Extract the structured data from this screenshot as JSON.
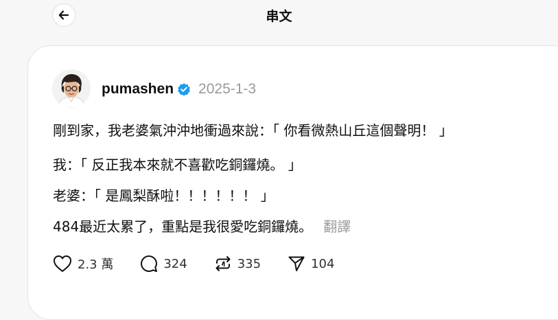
{
  "header": {
    "title": "串文",
    "back_icon": "arrow-left-icon"
  },
  "post": {
    "author": {
      "username": "pumashen",
      "verified": true,
      "verified_color": "#1d9bf0"
    },
    "date": "2025-1-3",
    "lines": [
      "剛到家，我老婆氣沖沖地衝過來說：「 你看微熱山丘這個聲明！ 」",
      "我：「 反正我本來就不喜歡吃銅鑼燒。 」",
      "老婆：「 是鳳梨酥啦！！！！！！ 」",
      "484最近太累了，重點是我很愛吃銅鑼燒。"
    ],
    "translate_label": "翻譯"
  },
  "actions": {
    "like": {
      "icon": "heart-icon",
      "count": "2.3 萬"
    },
    "comment": {
      "icon": "comment-icon",
      "count": "324"
    },
    "repost": {
      "icon": "repost-icon",
      "count": "335"
    },
    "share": {
      "icon": "send-icon",
      "count": "104"
    }
  }
}
